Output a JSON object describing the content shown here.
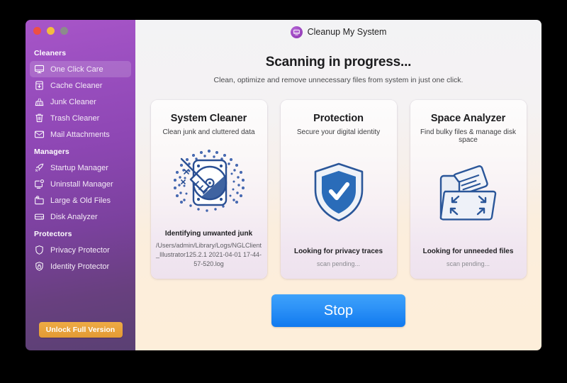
{
  "window": {
    "traffic_lights": [
      {
        "name": "close",
        "color": "#ee4f44"
      },
      {
        "name": "minimize",
        "color": "#f4bc3f"
      },
      {
        "name": "zoom",
        "color": "#8c8c8c"
      }
    ]
  },
  "sidebar": {
    "groups": [
      {
        "title": "Cleaners",
        "items": [
          {
            "label": "One Click Care",
            "icon": "monitor-icon",
            "active": true
          },
          {
            "label": "Cache Cleaner",
            "icon": "cache-bin-icon",
            "active": false
          },
          {
            "label": "Junk Cleaner",
            "icon": "broom-icon",
            "active": false
          },
          {
            "label": "Trash Cleaner",
            "icon": "trash-icon",
            "active": false
          },
          {
            "label": "Mail Attachments",
            "icon": "envelope-icon",
            "active": false
          }
        ]
      },
      {
        "title": "Managers",
        "items": [
          {
            "label": "Startup Manager",
            "icon": "rocket-icon",
            "active": false
          },
          {
            "label": "Uninstall Manager",
            "icon": "monitor-gear-icon",
            "active": false
          },
          {
            "label": "Large & Old Files",
            "icon": "folder-clock-icon",
            "active": false
          },
          {
            "label": "Disk Analyzer",
            "icon": "disk-icon",
            "active": false
          }
        ]
      },
      {
        "title": "Protectors",
        "items": [
          {
            "label": "Privacy Protector",
            "icon": "shield-icon",
            "active": false
          },
          {
            "label": "Identity Protector",
            "icon": "lock-shield-icon",
            "active": false
          }
        ]
      }
    ],
    "unlock_button": "Unlock Full Version",
    "unlock_color": "#e39a34",
    "background_top": "#a855c8",
    "background_bottom": "#5a4073"
  },
  "header": {
    "app_title": "Cleanup My System",
    "logo_icon": "cleanup-logo-icon"
  },
  "main": {
    "heading": "Scanning in progress...",
    "subheading": "Clean, optimize and remove unnecessary files from system in just one click.",
    "cards": [
      {
        "title": "System Cleaner",
        "subtitle": "Clean junk and cluttered data",
        "icon": "drive-broom-icon",
        "status": "Identifying unwanted junk",
        "detail": "/Users/admin/Library/Logs/NGLClient_Illustrator125.2.1 2021-04-01 17-44-57-520.log",
        "pending": false
      },
      {
        "title": "Protection",
        "subtitle": "Secure your digital identity",
        "icon": "shield-check-icon",
        "status": "Looking for privacy traces",
        "detail": "scan pending...",
        "pending": true
      },
      {
        "title": "Space Analyzer",
        "subtitle": "Find bulky files & manage disk space",
        "icon": "folder-expand-icon",
        "status": "Looking for unneeded files",
        "detail": "scan pending...",
        "pending": true
      }
    ],
    "stop_button": "Stop",
    "stop_button_color": "#1079ef"
  }
}
